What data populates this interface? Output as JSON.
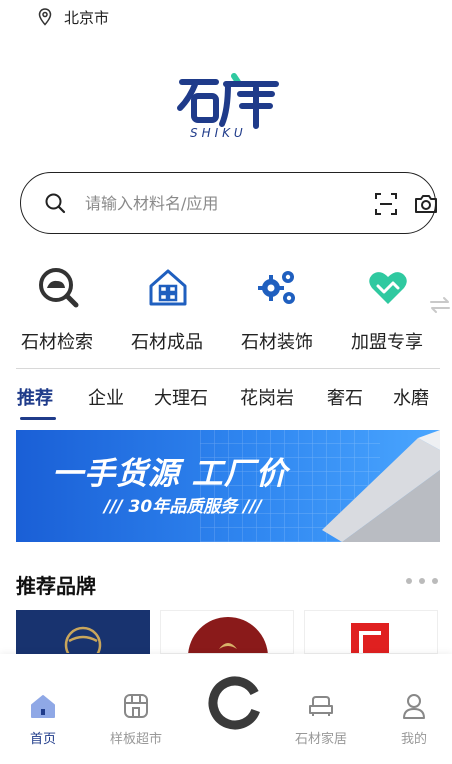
{
  "location": {
    "city": "北京市",
    "icon": "location-pin-icon"
  },
  "logo": {
    "sub": "SHIKU",
    "alt": "石库"
  },
  "search": {
    "placeholder": "请输入材料名/应用"
  },
  "categories": [
    {
      "label": "石材检索",
      "icon": "stone-search-icon"
    },
    {
      "label": "石材成品",
      "icon": "house-grid-icon"
    },
    {
      "label": "石材装饰",
      "icon": "gears-icon"
    },
    {
      "label": "加盟专享",
      "icon": "heart-handshake-icon"
    }
  ],
  "tabs": [
    "推荐",
    "企业",
    "大理石",
    "花岗岩",
    "奢石",
    "水磨"
  ],
  "active_tab": "推荐",
  "banner": {
    "headline": "一手货源 工厂价",
    "subline": "/// 30年品质服务 ///"
  },
  "brands": {
    "title": "推荐品牌"
  },
  "bottom_nav": [
    {
      "label": "首页",
      "icon": "home-icon",
      "active": true
    },
    {
      "label": "样板超市",
      "icon": "store-icon",
      "active": false
    },
    {
      "label": "",
      "icon": "center-logo-icon",
      "active": false
    },
    {
      "label": "石材家居",
      "icon": "sofa-icon",
      "active": false
    },
    {
      "label": "我的",
      "icon": "user-icon",
      "active": false
    }
  ],
  "colors": {
    "brand": "#1f3b8a",
    "accent_green": "#2fc9a0",
    "banner_blue": "#2f86f0"
  }
}
